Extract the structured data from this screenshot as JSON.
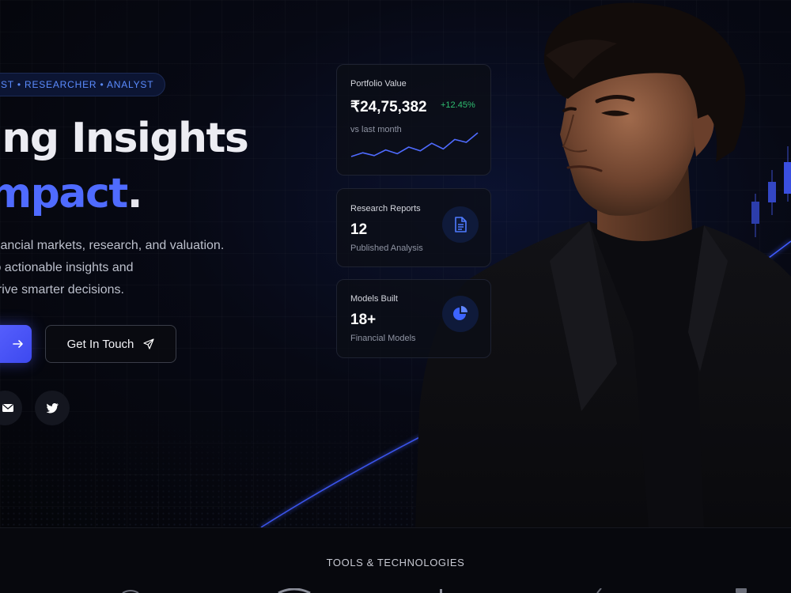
{
  "hero": {
    "roles_pill": "ST • RESEARCHER • ANALYST",
    "headline_line1": "ing Insights",
    "headline_line2": "mpact",
    "headline_dot": ".",
    "description": [
      "inancial markets, research, and valuation.",
      "to actionable insights and",
      "drive smarter decisions."
    ],
    "secondary_button_label": "Get In Touch",
    "social_icons": [
      "email-icon",
      "twitter-icon"
    ]
  },
  "cards": {
    "portfolio": {
      "title": "Portfolio Value",
      "value": "₹24,75,382",
      "change": "+12.45%",
      "subtitle": "vs last month",
      "sparkline": [
        30,
        26,
        29,
        23,
        27,
        20,
        24,
        16,
        22,
        12,
        15,
        5
      ]
    },
    "reports": {
      "title": "Research Reports",
      "value": "12",
      "subtitle": "Published Analysis",
      "icon": "document-icon"
    },
    "models": {
      "title": "Models Built",
      "value": "18+",
      "subtitle": "Financial Models",
      "icon": "pie-chart-icon"
    }
  },
  "footer": {
    "tools_title": "TOOLS & TECHNOLOGIES"
  },
  "colors": {
    "accent": "#4f6bff",
    "positive": "#2fbf71",
    "background": "#05060a"
  }
}
